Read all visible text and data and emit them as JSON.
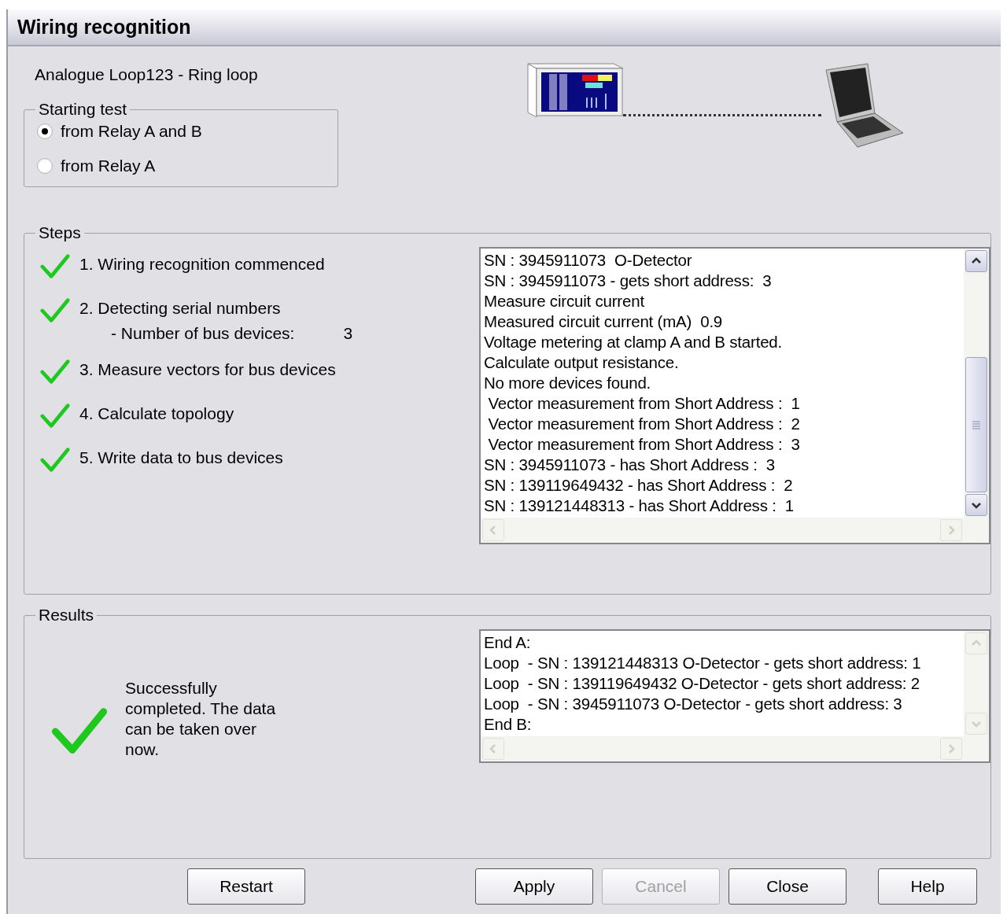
{
  "window": {
    "title": "Wiring recognition"
  },
  "loop_label": "Analogue Loop123 - Ring loop",
  "starting_test": {
    "title": "Starting test",
    "options": [
      {
        "label": "from Relay A and B",
        "selected": true
      },
      {
        "label": "from Relay A",
        "selected": false
      }
    ]
  },
  "steps": {
    "title": "Steps",
    "items": [
      {
        "label": "1. Wiring recognition commenced",
        "done": true
      },
      {
        "label": "2. Detecting serial numbers",
        "done": true,
        "detail": {
          "label": "- Number of bus devices:",
          "value": "3"
        }
      },
      {
        "label": "3. Measure vectors for bus devices",
        "done": true
      },
      {
        "label": "4. Calculate topology",
        "done": true
      },
      {
        "label": "5. Write data to bus devices",
        "done": true
      }
    ],
    "log": [
      "SN : 3945911073  O-Detector",
      "SN : 3945911073 - gets short address:  3",
      "Measure circuit current",
      "Measured circuit current (mA)  0.9",
      "Voltage metering at clamp A and B started.",
      "Calculate output resistance.",
      "No more devices found.",
      " Vector measurement from Short Address :  1",
      " Vector measurement from Short Address :  2",
      " Vector measurement from Short Address :  3",
      "SN : 3945911073 - has Short Address :  3",
      "SN : 139119649432 - has Short Address :  2",
      "SN : 139121448313 - has Short Address :  1"
    ]
  },
  "results": {
    "title": "Results",
    "success": true,
    "message": "Successfully completed. The data can be taken over now.",
    "log": [
      "End A:",
      "Loop  - SN : 139121448313 O-Detector - gets short address: 1",
      "Loop  - SN : 139119649432 O-Detector - gets short address: 2",
      "Loop  - SN : 3945911073 O-Detector - gets short address: 3",
      "End B:"
    ]
  },
  "buttons": [
    {
      "label": "Restart",
      "disabled": false,
      "kind": "left"
    },
    {
      "label": "Apply",
      "disabled": false,
      "kind": "right"
    },
    {
      "label": "Cancel",
      "disabled": true,
      "kind": "right"
    },
    {
      "label": "Close",
      "disabled": false,
      "kind": "right"
    },
    {
      "label": "Help",
      "disabled": false,
      "kind": "right"
    }
  ]
}
